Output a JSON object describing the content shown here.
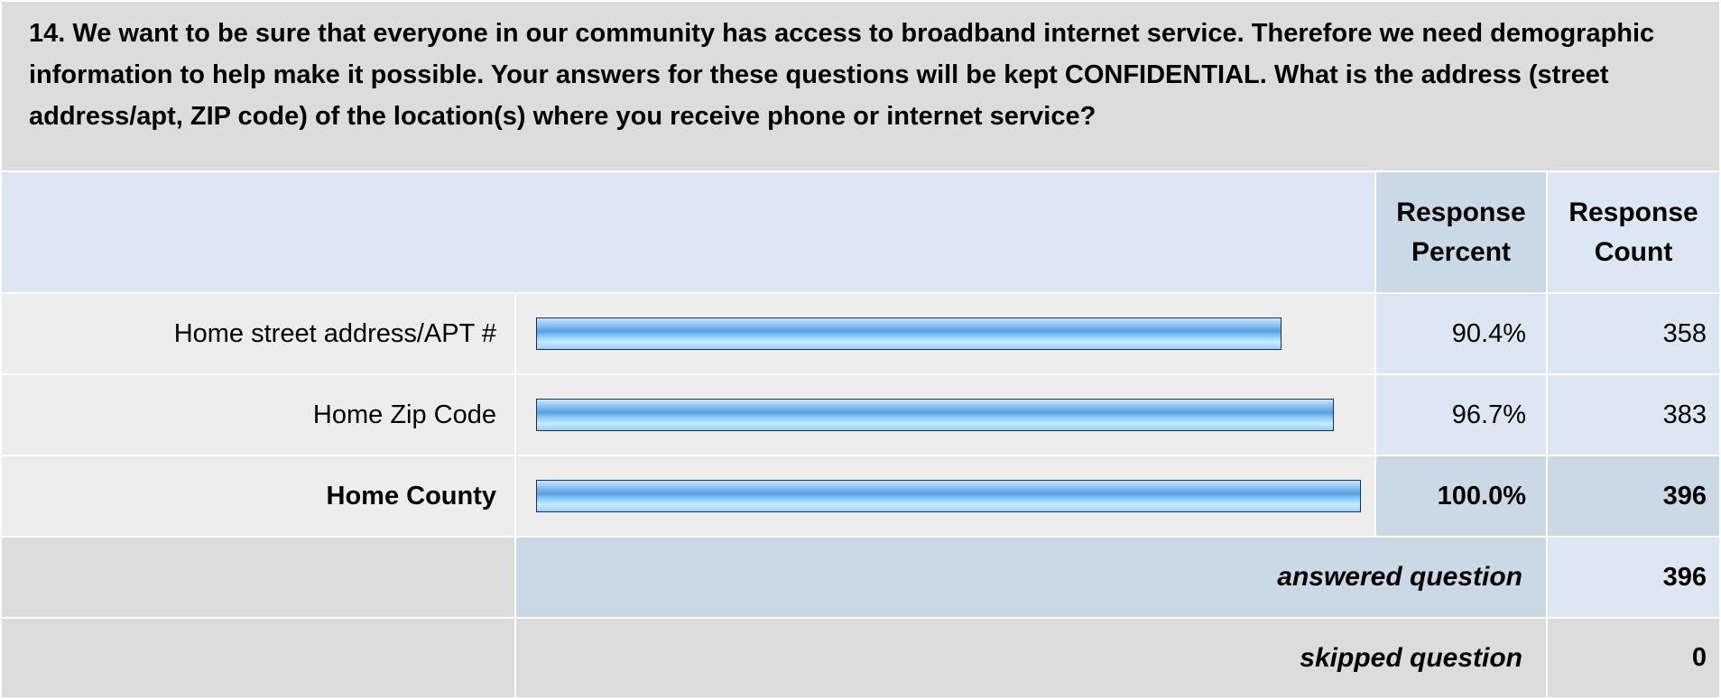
{
  "question": {
    "text": "14. We want to be sure that everyone in our community has access to broadband internet service. Therefore we need demographic information to help make it possible. Your answers for these questions will be kept CONFIDENTIAL. What is the address (street address/apt, ZIP code) of the location(s) where you receive phone or internet service?"
  },
  "headers": {
    "response_percent": "Response Percent",
    "response_count": "Response Count"
  },
  "rows": [
    {
      "label": "Home street address/APT #",
      "percent_text": "90.4%",
      "count": "358"
    },
    {
      "label": "Home Zip Code",
      "percent_text": "96.7%",
      "count": "383"
    },
    {
      "label": "Home County",
      "percent_text": "100.0%",
      "count": "396"
    }
  ],
  "summary": {
    "answered_label": "answered question",
    "answered_value": "396",
    "skipped_label": "skipped question",
    "skipped_value": "0"
  },
  "colors": {
    "bar_gradient_top": "#c7e9ff",
    "bar_gradient_mid": "#5a9fe6",
    "bar_border": "#1e2f52",
    "header_bg": "#dce7f3",
    "header_accent_bg": "#cbd8e5",
    "row_bg": "#ededed",
    "question_bg": "#dcdcdc"
  },
  "chart_data": {
    "type": "bar",
    "orientation": "horizontal",
    "categories": [
      "Home street address/APT #",
      "Home Zip Code",
      "Home County"
    ],
    "values": [
      90.4,
      96.7,
      100.0
    ],
    "counts": [
      358,
      383,
      396
    ],
    "xlim": [
      0,
      100
    ],
    "title": "",
    "xlabel": "",
    "ylabel": ""
  }
}
